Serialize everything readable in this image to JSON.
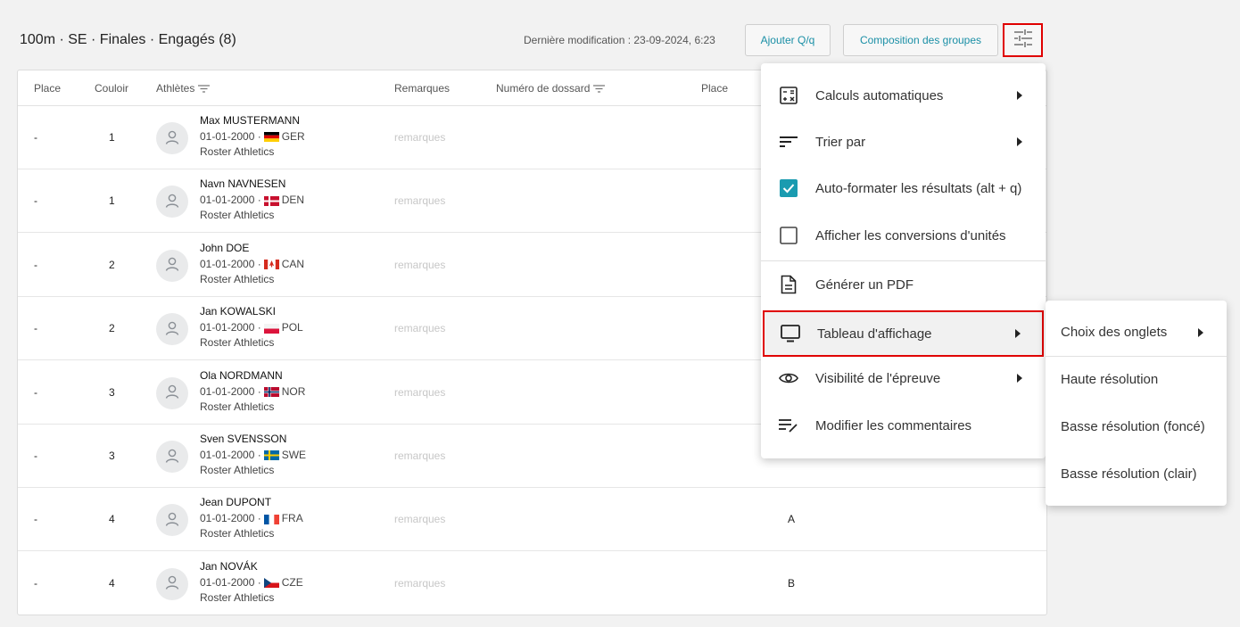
{
  "header": {
    "title": "100m · SE · Finales · Engagés (8)",
    "last_modified": "Dernière modification : 23-09-2024, 6:23",
    "add_button": "Ajouter Q/q",
    "groups_button": "Composition des groupes",
    "settings_icon": "sliders-icon"
  },
  "table": {
    "columns": {
      "place": "Place",
      "couloir": "Couloir",
      "athletes": "Athlètes",
      "remarques": "Remarques",
      "dossard": "Numéro de dossard",
      "place2": "Place"
    },
    "rows": [
      {
        "place": "-",
        "couloir": "1",
        "name": "Max MUSTERMANN",
        "dob": "01-01-2000 ·",
        "country": "GER",
        "club": "Roster Athletics",
        "remarks": "remarques",
        "extra": ""
      },
      {
        "place": "-",
        "couloir": "1",
        "name": "Navn NAVNESEN",
        "dob": "01-01-2000 ·",
        "country": "DEN",
        "club": "Roster Athletics",
        "remarks": "remarques",
        "extra": ""
      },
      {
        "place": "-",
        "couloir": "2",
        "name": "John DOE",
        "dob": "01-01-2000 ·",
        "country": "CAN",
        "club": "Roster Athletics",
        "remarks": "remarques",
        "extra": ""
      },
      {
        "place": "-",
        "couloir": "2",
        "name": "Jan KOWALSKI",
        "dob": "01-01-2000 ·",
        "country": "POL",
        "club": "Roster Athletics",
        "remarks": "remarques",
        "extra": ""
      },
      {
        "place": "-",
        "couloir": "3",
        "name": "Ola NORDMANN",
        "dob": "01-01-2000 ·",
        "country": "NOR",
        "club": "Roster Athletics",
        "remarks": "remarques",
        "extra": ""
      },
      {
        "place": "-",
        "couloir": "3",
        "name": "Sven SVENSSON",
        "dob": "01-01-2000 ·",
        "country": "SWE",
        "club": "Roster Athletics",
        "remarks": "remarques",
        "extra": ""
      },
      {
        "place": "-",
        "couloir": "4",
        "name": "Jean DUPONT",
        "dob": "01-01-2000 ·",
        "country": "FRA",
        "club": "Roster Athletics",
        "remarks": "remarques",
        "extra": "A"
      },
      {
        "place": "-",
        "couloir": "4",
        "name": "Jan NOVÁK",
        "dob": "01-01-2000 ·",
        "country": "CZE",
        "club": "Roster Athletics",
        "remarks": "remarques",
        "extra": "B"
      }
    ]
  },
  "menu": {
    "items": [
      {
        "label": "Calculs automatiques",
        "icon": "calculator-icon"
      },
      {
        "label": "Trier par",
        "icon": "sort-icon"
      },
      {
        "label": "Auto-formater les résultats (alt + q)",
        "icon": "checkbox-checked-icon"
      },
      {
        "label": "Afficher les conversions d'unités",
        "icon": "checkbox-empty-icon"
      },
      {
        "label": "Générer un PDF",
        "icon": "document-icon"
      },
      {
        "label": "Tableau d'affichage",
        "icon": "monitor-icon"
      },
      {
        "label": "Visibilité de l'épreuve",
        "icon": "eye-icon"
      },
      {
        "label": "Modifier les commentaires",
        "icon": "edit-notes-icon"
      }
    ],
    "accent": "#1a9bb0"
  },
  "submenu": {
    "items": [
      {
        "label": "Choix des onglets"
      },
      {
        "label": "Haute résolution"
      },
      {
        "label": "Basse résolution (foncé)"
      },
      {
        "label": "Basse résolution (clair)"
      }
    ]
  }
}
